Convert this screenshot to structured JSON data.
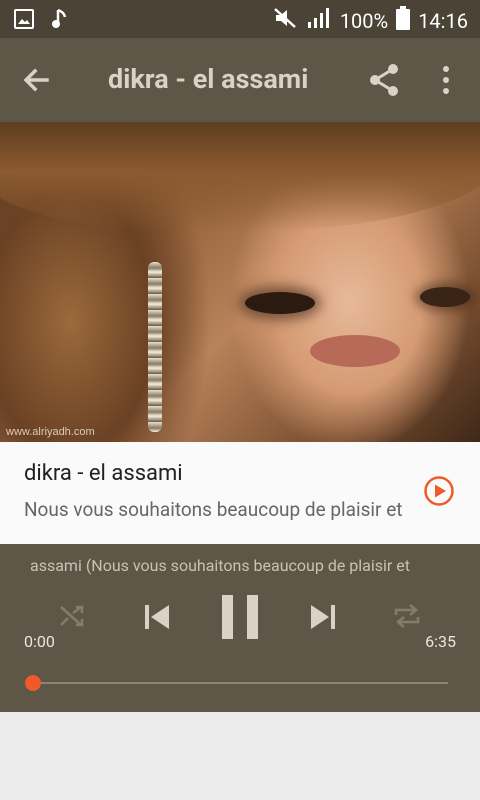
{
  "status": {
    "battery_percent": "100%",
    "time": "14:16",
    "icons": [
      "image-icon",
      "music-icon",
      "mute-icon",
      "signal-icon",
      "battery-icon"
    ]
  },
  "appbar": {
    "title": "dikra - el assami"
  },
  "artwork": {
    "watermark": "www.alriyadh.com"
  },
  "track": {
    "name": "dikra - el assami",
    "description": "Nous vous souhaitons beaucoup de plaisir et"
  },
  "player": {
    "marquee": "assami (Nous vous souhaitons beaucoup de plaisir et",
    "elapsed": "0:00",
    "duration": "6:35",
    "progress_fraction": 0.0
  },
  "colors": {
    "accent": "#f05a28",
    "bar": "#5e5747",
    "statusbar": "#4a4336"
  }
}
